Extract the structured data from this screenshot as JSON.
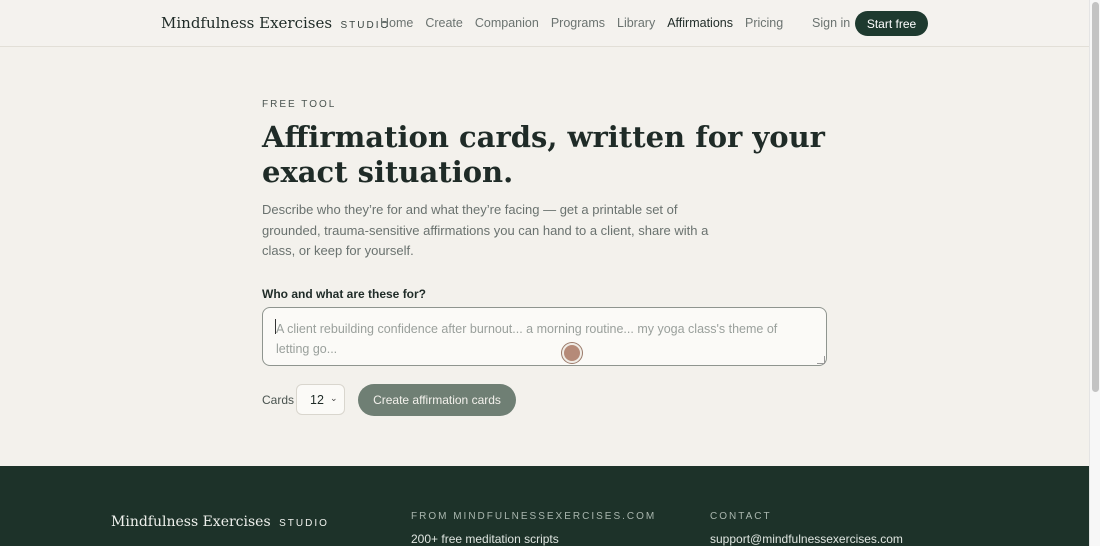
{
  "header": {
    "brand_name": "Mindfulness Exercises",
    "brand_suffix": "STUDIO",
    "nav": [
      "Home",
      "Create",
      "Companion",
      "Programs",
      "Library",
      "Affirmations",
      "Pricing"
    ],
    "active_nav": "Affirmations",
    "sign_in": "Sign in",
    "start_free": "Start free"
  },
  "hero": {
    "eyebrow": "FREE TOOL",
    "title": "Affirmation cards, written for your exact situation.",
    "lead": "Describe who they’re for and what they’re facing — get a printable set of grounded, trauma-sensitive affirmations you can hand to a client, share with a class, or keep for yourself.",
    "field_label": "Who and what are these for?",
    "textarea_placeholder": "A client rebuilding confidence after burnout... a morning routine... my yoga class's theme of letting go...",
    "cards_label": "Cards",
    "cards_value": "12",
    "create_button": "Create affirmation cards"
  },
  "footer": {
    "brand_name": "Mindfulness Exercises",
    "brand_suffix": "STUDIO",
    "from_title": "FROM MINDFULNESSEXERCISES.COM",
    "from_link": "200+ free meditation scripts",
    "contact_title": "CONTACT",
    "contact_email": "support@mindfulnessexercises.com"
  },
  "colors": {
    "accent": "#1e3a2f",
    "button_muted": "#6f7f74",
    "background": "#f3f1ec",
    "footer": "#1d3229"
  }
}
